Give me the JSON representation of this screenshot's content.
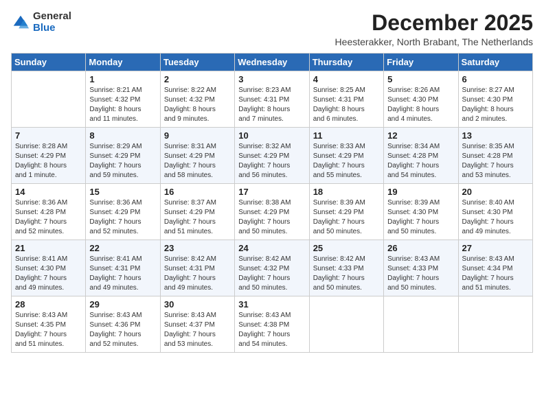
{
  "logo": {
    "general": "General",
    "blue": "Blue"
  },
  "title": "December 2025",
  "subtitle": "Heesterakker, North Brabant, The Netherlands",
  "days_of_week": [
    "Sunday",
    "Monday",
    "Tuesday",
    "Wednesday",
    "Thursday",
    "Friday",
    "Saturday"
  ],
  "weeks": [
    [
      {
        "day": "",
        "info": ""
      },
      {
        "day": "1",
        "info": "Sunrise: 8:21 AM\nSunset: 4:32 PM\nDaylight: 8 hours\nand 11 minutes."
      },
      {
        "day": "2",
        "info": "Sunrise: 8:22 AM\nSunset: 4:32 PM\nDaylight: 8 hours\nand 9 minutes."
      },
      {
        "day": "3",
        "info": "Sunrise: 8:23 AM\nSunset: 4:31 PM\nDaylight: 8 hours\nand 7 minutes."
      },
      {
        "day": "4",
        "info": "Sunrise: 8:25 AM\nSunset: 4:31 PM\nDaylight: 8 hours\nand 6 minutes."
      },
      {
        "day": "5",
        "info": "Sunrise: 8:26 AM\nSunset: 4:30 PM\nDaylight: 8 hours\nand 4 minutes."
      },
      {
        "day": "6",
        "info": "Sunrise: 8:27 AM\nSunset: 4:30 PM\nDaylight: 8 hours\nand 2 minutes."
      }
    ],
    [
      {
        "day": "7",
        "info": "Sunrise: 8:28 AM\nSunset: 4:29 PM\nDaylight: 8 hours\nand 1 minute."
      },
      {
        "day": "8",
        "info": "Sunrise: 8:29 AM\nSunset: 4:29 PM\nDaylight: 7 hours\nand 59 minutes."
      },
      {
        "day": "9",
        "info": "Sunrise: 8:31 AM\nSunset: 4:29 PM\nDaylight: 7 hours\nand 58 minutes."
      },
      {
        "day": "10",
        "info": "Sunrise: 8:32 AM\nSunset: 4:29 PM\nDaylight: 7 hours\nand 56 minutes."
      },
      {
        "day": "11",
        "info": "Sunrise: 8:33 AM\nSunset: 4:29 PM\nDaylight: 7 hours\nand 55 minutes."
      },
      {
        "day": "12",
        "info": "Sunrise: 8:34 AM\nSunset: 4:28 PM\nDaylight: 7 hours\nand 54 minutes."
      },
      {
        "day": "13",
        "info": "Sunrise: 8:35 AM\nSunset: 4:28 PM\nDaylight: 7 hours\nand 53 minutes."
      }
    ],
    [
      {
        "day": "14",
        "info": "Sunrise: 8:36 AM\nSunset: 4:28 PM\nDaylight: 7 hours\nand 52 minutes."
      },
      {
        "day": "15",
        "info": "Sunrise: 8:36 AM\nSunset: 4:29 PM\nDaylight: 7 hours\nand 52 minutes."
      },
      {
        "day": "16",
        "info": "Sunrise: 8:37 AM\nSunset: 4:29 PM\nDaylight: 7 hours\nand 51 minutes."
      },
      {
        "day": "17",
        "info": "Sunrise: 8:38 AM\nSunset: 4:29 PM\nDaylight: 7 hours\nand 50 minutes."
      },
      {
        "day": "18",
        "info": "Sunrise: 8:39 AM\nSunset: 4:29 PM\nDaylight: 7 hours\nand 50 minutes."
      },
      {
        "day": "19",
        "info": "Sunrise: 8:39 AM\nSunset: 4:30 PM\nDaylight: 7 hours\nand 50 minutes."
      },
      {
        "day": "20",
        "info": "Sunrise: 8:40 AM\nSunset: 4:30 PM\nDaylight: 7 hours\nand 49 minutes."
      }
    ],
    [
      {
        "day": "21",
        "info": "Sunrise: 8:41 AM\nSunset: 4:30 PM\nDaylight: 7 hours\nand 49 minutes."
      },
      {
        "day": "22",
        "info": "Sunrise: 8:41 AM\nSunset: 4:31 PM\nDaylight: 7 hours\nand 49 minutes."
      },
      {
        "day": "23",
        "info": "Sunrise: 8:42 AM\nSunset: 4:31 PM\nDaylight: 7 hours\nand 49 minutes."
      },
      {
        "day": "24",
        "info": "Sunrise: 8:42 AM\nSunset: 4:32 PM\nDaylight: 7 hours\nand 50 minutes."
      },
      {
        "day": "25",
        "info": "Sunrise: 8:42 AM\nSunset: 4:33 PM\nDaylight: 7 hours\nand 50 minutes."
      },
      {
        "day": "26",
        "info": "Sunrise: 8:43 AM\nSunset: 4:33 PM\nDaylight: 7 hours\nand 50 minutes."
      },
      {
        "day": "27",
        "info": "Sunrise: 8:43 AM\nSunset: 4:34 PM\nDaylight: 7 hours\nand 51 minutes."
      }
    ],
    [
      {
        "day": "28",
        "info": "Sunrise: 8:43 AM\nSunset: 4:35 PM\nDaylight: 7 hours\nand 51 minutes."
      },
      {
        "day": "29",
        "info": "Sunrise: 8:43 AM\nSunset: 4:36 PM\nDaylight: 7 hours\nand 52 minutes."
      },
      {
        "day": "30",
        "info": "Sunrise: 8:43 AM\nSunset: 4:37 PM\nDaylight: 7 hours\nand 53 minutes."
      },
      {
        "day": "31",
        "info": "Sunrise: 8:43 AM\nSunset: 4:38 PM\nDaylight: 7 hours\nand 54 minutes."
      },
      {
        "day": "",
        "info": ""
      },
      {
        "day": "",
        "info": ""
      },
      {
        "day": "",
        "info": ""
      }
    ]
  ]
}
